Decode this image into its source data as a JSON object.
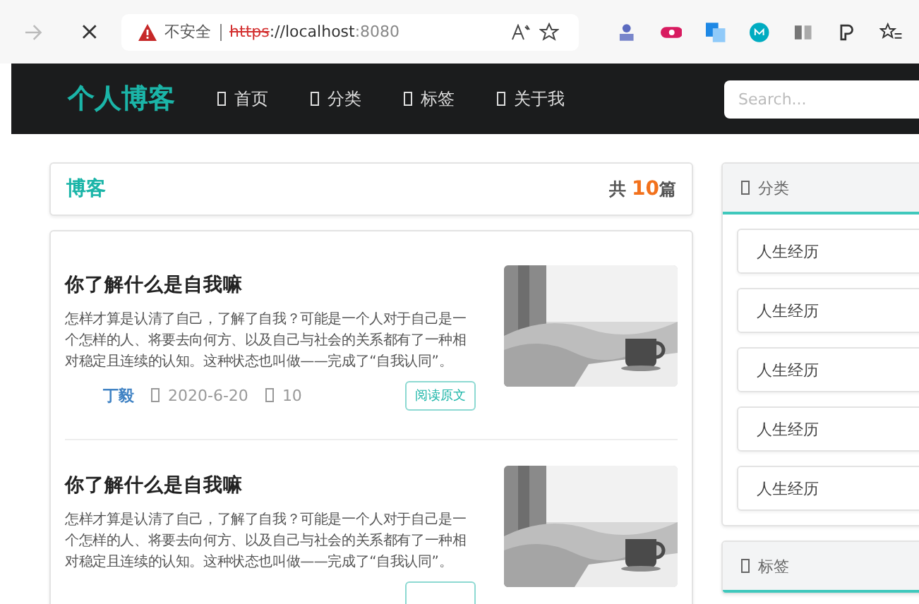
{
  "browser": {
    "security_label": "不安全",
    "url_scheme": "https",
    "url_host": "://localhost",
    "url_port": ":8080"
  },
  "nav": {
    "logo": "个人博客",
    "items": [
      {
        "label": "首页"
      },
      {
        "label": "分类"
      },
      {
        "label": "标签"
      },
      {
        "label": "关于我"
      }
    ],
    "search": {
      "placeholder": "Search..."
    }
  },
  "blog_header": {
    "title": "博客",
    "count_prefix": "共",
    "count": "10",
    "count_suffix": "篇"
  },
  "posts": [
    {
      "title": "你了解什么是自我嘛",
      "summary": "怎样才算是认清了自己，了解了自我？可能是一个人对于自己是一个怎样的人、将要去向何方、以及自己与社会的关系都有了一种相对稳定且连续的认知。这种状态也叫做——完成了“自我认同”。",
      "author": "丁毅",
      "date": "2020-6-20",
      "views": "10",
      "read_button": "阅读原文"
    },
    {
      "title": "你了解什么是自我嘛",
      "summary": "怎样才算是认清了自己，了解了自我？可能是一个人对于自己是一个怎样的人、将要去向何方、以及自己与社会的关系都有了一种相对稳定且连续的认知。这种状态也叫做——完成了“自我认同”。"
    }
  ],
  "categories": {
    "title": "分类",
    "items": [
      "人生经历",
      "人生经历",
      "人生经历",
      "人生经历",
      "人生经历"
    ]
  },
  "tags": {
    "title": "标签"
  }
}
